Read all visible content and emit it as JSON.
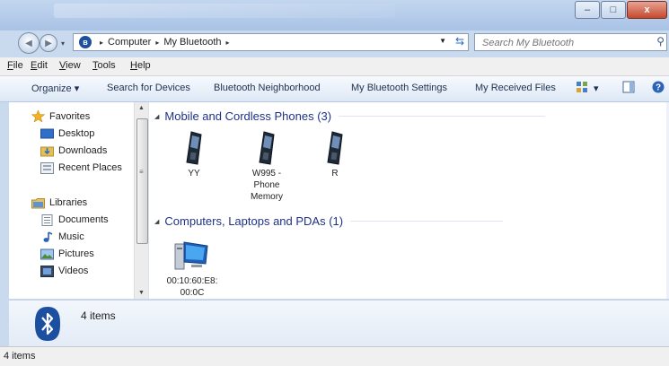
{
  "titlebar": {
    "minimize_glyph": "–",
    "maximize_glyph": "□",
    "close_glyph": "x"
  },
  "address": {
    "crumbs": [
      "Computer",
      "My Bluetooth"
    ],
    "separator": "▸",
    "search_placeholder": "Search My Bluetooth"
  },
  "menu": {
    "items": [
      {
        "acc": "F",
        "rest": "ile"
      },
      {
        "acc": "E",
        "rest": "dit"
      },
      {
        "acc": "V",
        "rest": "iew"
      },
      {
        "acc": "T",
        "rest": "ools"
      },
      {
        "acc": "H",
        "rest": "elp"
      }
    ]
  },
  "toolbar": {
    "organize": "Organize ▾",
    "search_devices": "Search for Devices",
    "neighborhood": "Bluetooth Neighborhood",
    "settings": "My Bluetooth Settings",
    "received": "My Received Files",
    "view_dropdown": "▾"
  },
  "sidebar": {
    "favorites_label": "Favorites",
    "favorites": [
      "Desktop",
      "Downloads",
      "Recent Places"
    ],
    "libraries_label": "Libraries",
    "libraries": [
      "Documents",
      "Music",
      "Pictures",
      "Videos"
    ]
  },
  "groups": {
    "phones_title": "Mobile and Cordless Phones (3)",
    "phones": [
      {
        "lines": [
          "YY"
        ]
      },
      {
        "lines": [
          "W995 -",
          "Phone",
          "Memory"
        ]
      },
      {
        "lines": [
          "R"
        ]
      }
    ],
    "computers_title": "Computers, Laptops and PDAs (1)",
    "computers": [
      {
        "lines": [
          "00:10:60:E8:",
          "00:0C"
        ]
      }
    ]
  },
  "details": {
    "count": "4 items"
  },
  "status": {
    "text": "4 items"
  },
  "colors": {
    "group_header": "#1e3287",
    "bluetooth": "#1d4fa0"
  }
}
